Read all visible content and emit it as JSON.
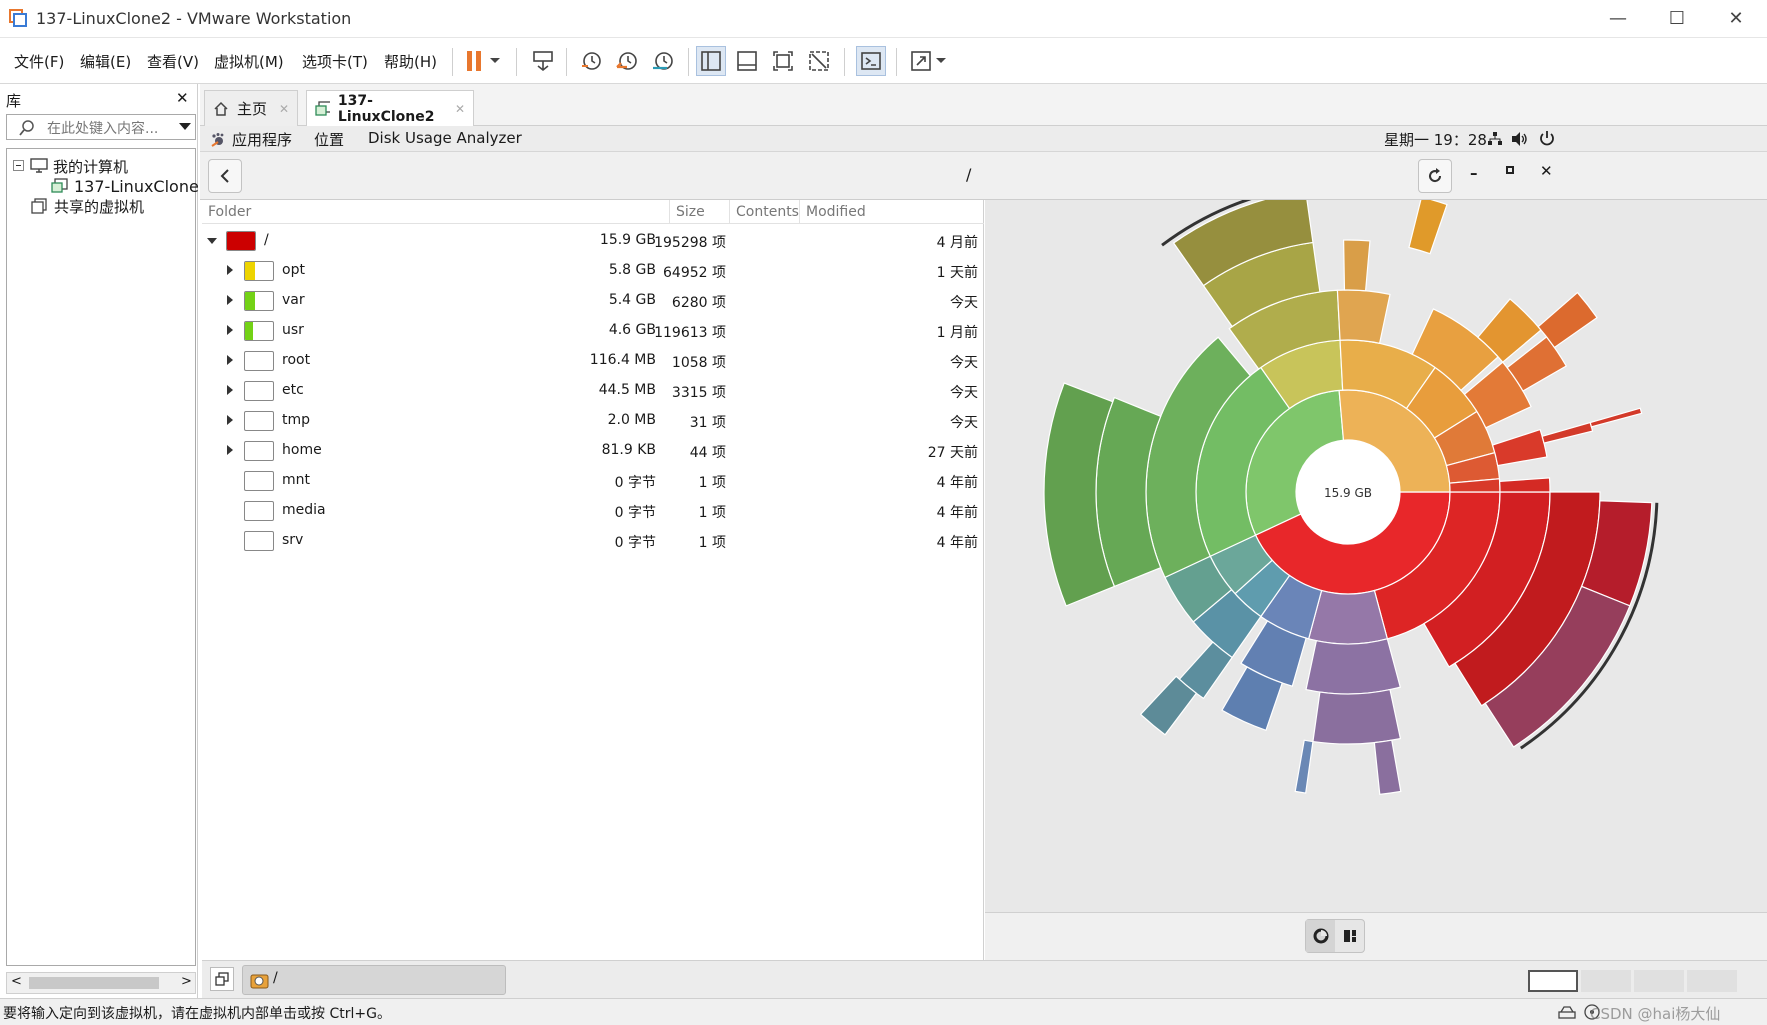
{
  "window": {
    "title": "137-LinuxClone2 - VMware Workstation",
    "minimize": "—",
    "maximize": "☐",
    "close": "✕"
  },
  "menu": [
    "文件(F)",
    "编辑(E)",
    "查看(V)",
    "虚拟机(M)",
    "选项卡(T)",
    "帮助(H)"
  ],
  "library": {
    "title": "库",
    "close": "✕",
    "search_placeholder": "在此处键入内容...",
    "tree": [
      {
        "label": "我的计算机"
      },
      {
        "label": "137-LinuxClone"
      },
      {
        "label": "共享的虚拟机"
      }
    ]
  },
  "tabs": [
    {
      "label": "主页",
      "close": "✕"
    },
    {
      "label": "137-LinuxClone2",
      "close": "✕"
    }
  ],
  "gnome": {
    "apps": "应用程序",
    "places": "位置",
    "app_name": "Disk Usage Analyzer",
    "clock": "星期一 19：28"
  },
  "app": {
    "path": "/",
    "columns": [
      "Folder",
      "Size",
      "Contents",
      "Modified"
    ],
    "rows": [
      {
        "name": "/",
        "size": "15.9 GB",
        "contents": "195298 项",
        "modified": "4 月前",
        "color": "#cc0000",
        "fill": 1.0,
        "expanded": true,
        "indent": 0
      },
      {
        "name": "opt",
        "size": "5.8 GB",
        "contents": "64952 项",
        "modified": "1 天前",
        "color": "#edd400",
        "fill": 0.37,
        "expandable": true,
        "indent": 1
      },
      {
        "name": "var",
        "size": "5.4 GB",
        "contents": "6280 项",
        "modified": "今天",
        "color": "#73d216",
        "fill": 0.34,
        "expandable": true,
        "indent": 1
      },
      {
        "name": "usr",
        "size": "4.6 GB",
        "contents": "119613 项",
        "modified": "1 月前",
        "color": "#73d216",
        "fill": 0.29,
        "expandable": true,
        "indent": 1
      },
      {
        "name": "root",
        "size": "116.4 MB",
        "contents": "1058 项",
        "modified": "今天",
        "color": "#ffffff",
        "fill": 0,
        "expandable": true,
        "indent": 1
      },
      {
        "name": "etc",
        "size": "44.5 MB",
        "contents": "3315 项",
        "modified": "今天",
        "color": "#ffffff",
        "fill": 0,
        "expandable": true,
        "indent": 1
      },
      {
        "name": "tmp",
        "size": "2.0 MB",
        "contents": "31 项",
        "modified": "今天",
        "color": "#ffffff",
        "fill": 0,
        "expandable": true,
        "indent": 1
      },
      {
        "name": "home",
        "size": "81.9 KB",
        "contents": "44 项",
        "modified": "27 天前",
        "color": "#ffffff",
        "fill": 0,
        "expandable": true,
        "indent": 1
      },
      {
        "name": "mnt",
        "size": "0 字节",
        "contents": "1 项",
        "modified": "4 年前",
        "color": "#ffffff",
        "fill": 0,
        "expandable": false,
        "indent": 1
      },
      {
        "name": "media",
        "size": "0 字节",
        "contents": "1 项",
        "modified": "4 年前",
        "color": "#ffffff",
        "fill": 0,
        "expandable": false,
        "indent": 1
      },
      {
        "name": "srv",
        "size": "0 字节",
        "contents": "1 项",
        "modified": "4 年前",
        "color": "#ffffff",
        "fill": 0,
        "expandable": false,
        "indent": 1
      }
    ],
    "center_label": "15.9 GB",
    "bottom_path": "/"
  },
  "status": {
    "text": "要将输入定向到该虚拟机，请在虚拟机内部单击或按 Ctrl+G。",
    "watermark": "CSDN @hai杨大仙"
  },
  "colors": {
    "accent_orange": "#e8772e",
    "root_red": "#cc0000"
  }
}
